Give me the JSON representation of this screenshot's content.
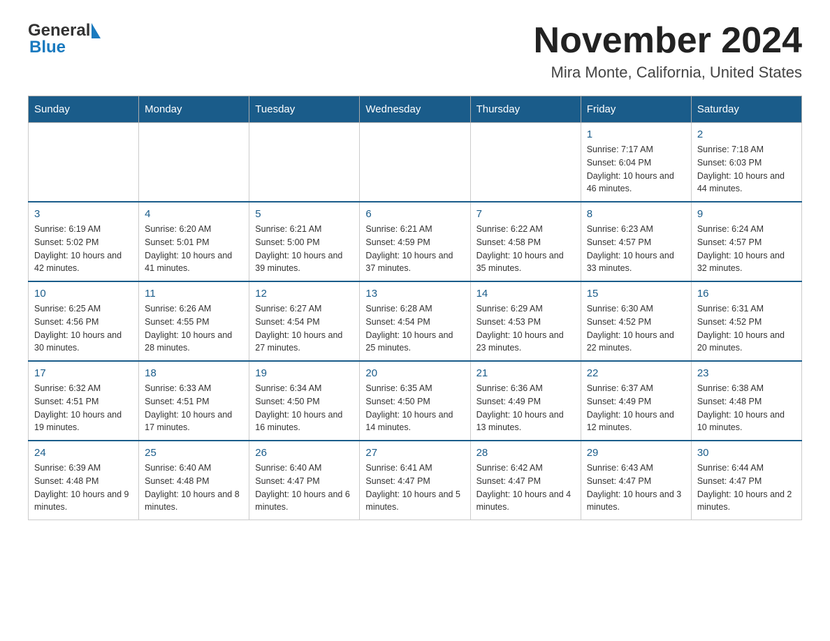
{
  "header": {
    "logo_general": "General",
    "logo_blue": "Blue",
    "month_title": "November 2024",
    "location": "Mira Monte, California, United States"
  },
  "days_of_week": [
    "Sunday",
    "Monday",
    "Tuesday",
    "Wednesday",
    "Thursday",
    "Friday",
    "Saturday"
  ],
  "weeks": [
    [
      {
        "day": "",
        "info": ""
      },
      {
        "day": "",
        "info": ""
      },
      {
        "day": "",
        "info": ""
      },
      {
        "day": "",
        "info": ""
      },
      {
        "day": "",
        "info": ""
      },
      {
        "day": "1",
        "info": "Sunrise: 7:17 AM\nSunset: 6:04 PM\nDaylight: 10 hours and 46 minutes."
      },
      {
        "day": "2",
        "info": "Sunrise: 7:18 AM\nSunset: 6:03 PM\nDaylight: 10 hours and 44 minutes."
      }
    ],
    [
      {
        "day": "3",
        "info": "Sunrise: 6:19 AM\nSunset: 5:02 PM\nDaylight: 10 hours and 42 minutes."
      },
      {
        "day": "4",
        "info": "Sunrise: 6:20 AM\nSunset: 5:01 PM\nDaylight: 10 hours and 41 minutes."
      },
      {
        "day": "5",
        "info": "Sunrise: 6:21 AM\nSunset: 5:00 PM\nDaylight: 10 hours and 39 minutes."
      },
      {
        "day": "6",
        "info": "Sunrise: 6:21 AM\nSunset: 4:59 PM\nDaylight: 10 hours and 37 minutes."
      },
      {
        "day": "7",
        "info": "Sunrise: 6:22 AM\nSunset: 4:58 PM\nDaylight: 10 hours and 35 minutes."
      },
      {
        "day": "8",
        "info": "Sunrise: 6:23 AM\nSunset: 4:57 PM\nDaylight: 10 hours and 33 minutes."
      },
      {
        "day": "9",
        "info": "Sunrise: 6:24 AM\nSunset: 4:57 PM\nDaylight: 10 hours and 32 minutes."
      }
    ],
    [
      {
        "day": "10",
        "info": "Sunrise: 6:25 AM\nSunset: 4:56 PM\nDaylight: 10 hours and 30 minutes."
      },
      {
        "day": "11",
        "info": "Sunrise: 6:26 AM\nSunset: 4:55 PM\nDaylight: 10 hours and 28 minutes."
      },
      {
        "day": "12",
        "info": "Sunrise: 6:27 AM\nSunset: 4:54 PM\nDaylight: 10 hours and 27 minutes."
      },
      {
        "day": "13",
        "info": "Sunrise: 6:28 AM\nSunset: 4:54 PM\nDaylight: 10 hours and 25 minutes."
      },
      {
        "day": "14",
        "info": "Sunrise: 6:29 AM\nSunset: 4:53 PM\nDaylight: 10 hours and 23 minutes."
      },
      {
        "day": "15",
        "info": "Sunrise: 6:30 AM\nSunset: 4:52 PM\nDaylight: 10 hours and 22 minutes."
      },
      {
        "day": "16",
        "info": "Sunrise: 6:31 AM\nSunset: 4:52 PM\nDaylight: 10 hours and 20 minutes."
      }
    ],
    [
      {
        "day": "17",
        "info": "Sunrise: 6:32 AM\nSunset: 4:51 PM\nDaylight: 10 hours and 19 minutes."
      },
      {
        "day": "18",
        "info": "Sunrise: 6:33 AM\nSunset: 4:51 PM\nDaylight: 10 hours and 17 minutes."
      },
      {
        "day": "19",
        "info": "Sunrise: 6:34 AM\nSunset: 4:50 PM\nDaylight: 10 hours and 16 minutes."
      },
      {
        "day": "20",
        "info": "Sunrise: 6:35 AM\nSunset: 4:50 PM\nDaylight: 10 hours and 14 minutes."
      },
      {
        "day": "21",
        "info": "Sunrise: 6:36 AM\nSunset: 4:49 PM\nDaylight: 10 hours and 13 minutes."
      },
      {
        "day": "22",
        "info": "Sunrise: 6:37 AM\nSunset: 4:49 PM\nDaylight: 10 hours and 12 minutes."
      },
      {
        "day": "23",
        "info": "Sunrise: 6:38 AM\nSunset: 4:48 PM\nDaylight: 10 hours and 10 minutes."
      }
    ],
    [
      {
        "day": "24",
        "info": "Sunrise: 6:39 AM\nSunset: 4:48 PM\nDaylight: 10 hours and 9 minutes."
      },
      {
        "day": "25",
        "info": "Sunrise: 6:40 AM\nSunset: 4:48 PM\nDaylight: 10 hours and 8 minutes."
      },
      {
        "day": "26",
        "info": "Sunrise: 6:40 AM\nSunset: 4:47 PM\nDaylight: 10 hours and 6 minutes."
      },
      {
        "day": "27",
        "info": "Sunrise: 6:41 AM\nSunset: 4:47 PM\nDaylight: 10 hours and 5 minutes."
      },
      {
        "day": "28",
        "info": "Sunrise: 6:42 AM\nSunset: 4:47 PM\nDaylight: 10 hours and 4 minutes."
      },
      {
        "day": "29",
        "info": "Sunrise: 6:43 AM\nSunset: 4:47 PM\nDaylight: 10 hours and 3 minutes."
      },
      {
        "day": "30",
        "info": "Sunrise: 6:44 AM\nSunset: 4:47 PM\nDaylight: 10 hours and 2 minutes."
      }
    ]
  ]
}
